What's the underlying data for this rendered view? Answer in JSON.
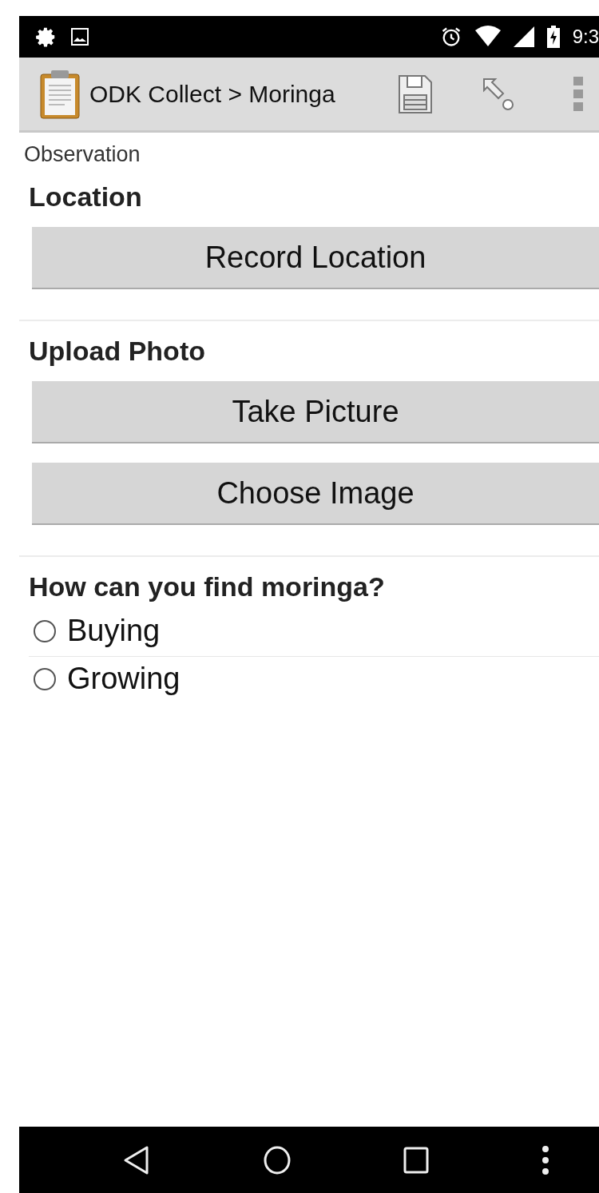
{
  "status_bar": {
    "time": "9:3"
  },
  "toolbar": {
    "title": "ODK Collect > Moringa"
  },
  "form": {
    "group": "Observation",
    "questions": [
      {
        "kind": "buttons",
        "label": "Location",
        "buttons": [
          "Record Location"
        ]
      },
      {
        "kind": "buttons",
        "label": "Upload Photo",
        "buttons": [
          "Take Picture",
          "Choose Image"
        ]
      },
      {
        "kind": "choice",
        "label": "How can you find moringa?",
        "options": [
          {
            "label": "Buying",
            "selected": false
          },
          {
            "label": "Growing",
            "selected": false
          }
        ]
      }
    ]
  }
}
